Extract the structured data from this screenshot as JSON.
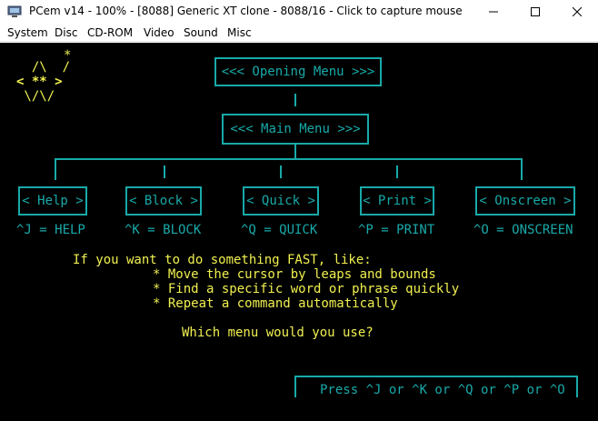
{
  "window": {
    "title": "PCem v14 - 100% - [8088] Generic XT clone - 8088/16 - Click to capture mouse"
  },
  "menubar": {
    "items": [
      "System",
      "Disc",
      "CD-ROM",
      "Video",
      "Sound",
      "Misc"
    ]
  },
  "screen": {
    "logo": {
      "line1": "  /\\  /",
      "line2": "< ** >",
      "line3": " \\/\\/",
      "star": "*"
    },
    "opening_menu": "<<< Opening Menu >>>",
    "main_menu": "<<< Main Menu >>>",
    "submenus": [
      {
        "label": "< Help >",
        "key": "^J = HELP"
      },
      {
        "label": "< Block >",
        "key": "^K = BLOCK"
      },
      {
        "label": "< Quick >",
        "key": "^Q = QUICK"
      },
      {
        "label": "< Print >",
        "key": "^P = PRINT"
      },
      {
        "label": "< Onscreen >",
        "key": "^O = ONSCREEN"
      }
    ],
    "prompt": {
      "intro": "If you want to do something FAST, like:",
      "bullets": [
        "* Move the cursor by leaps and bounds",
        "* Find a specific word or phrase quickly",
        "* Repeat a command automatically"
      ],
      "question": "Which menu would you use?"
    },
    "answer_bar": "Press ^J or ^K or ^Q or ^P or ^O"
  },
  "colors": {
    "cyan": "#19a9a9",
    "yellow": "#f0f050",
    "background": "#000000"
  }
}
